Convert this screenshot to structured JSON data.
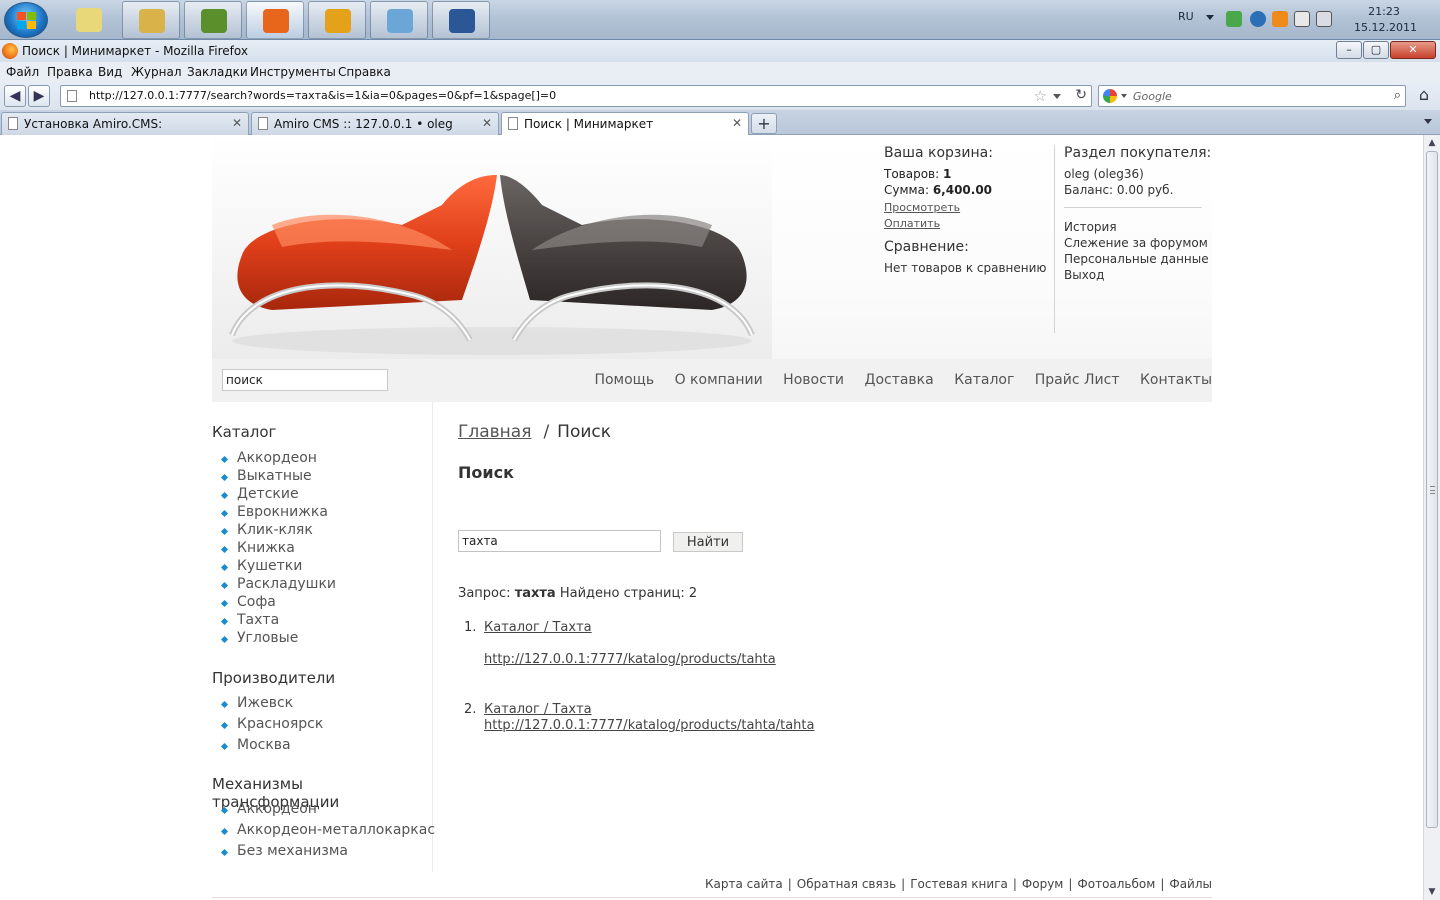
{
  "taskbar": {
    "language": "RU",
    "time": "21:23",
    "date": "15.12.2011",
    "apps": [
      {
        "name": "explorer-icon",
        "color": "#d9b24a"
      },
      {
        "name": "plant-icon",
        "color": "#5a8f2c"
      },
      {
        "name": "firefox-icon",
        "color": "#e8651c"
      },
      {
        "name": "aimp-icon",
        "color": "#e4a21a"
      },
      {
        "name": "notepad-icon",
        "color": "#6aa7d6"
      },
      {
        "name": "word-icon",
        "color": "#2b5797"
      }
    ]
  },
  "window": {
    "title": "Поиск | Минимаркет - Mozilla Firefox"
  },
  "menu": [
    "Файл",
    "Правка",
    "Вид",
    "Журнал",
    "Закладки",
    "Инструменты",
    "Справка"
  ],
  "nav": {
    "url": "http://127.0.0.1:7777/search?words=тахта&is=1&ia=0&pages=0&pf=1&spage[]=0",
    "search_placeholder": "Google"
  },
  "tabs": [
    {
      "label": "Установка Amiro.CMS:"
    },
    {
      "label": "Amiro CMS :: 127.0.0.1 • oleg"
    },
    {
      "label": "Поиск | Минимаркет"
    }
  ],
  "header": {
    "cart": {
      "title": "Ваша корзина:",
      "items_label": "Товаров:",
      "items_value": "1",
      "sum_label": "Сумма:",
      "sum_value": "6,400.00",
      "view_link": "Просмотреть",
      "pay_link": "Оплатить"
    },
    "compare": {
      "title": "Сравнение:",
      "empty": "Нет товаров к сравнению"
    },
    "user": {
      "title": "Раздел покупателя:",
      "name": "oleg (oleg36)",
      "balance": "Баланс: 0.00 руб.",
      "links": [
        "История",
        "Слежение за форумом",
        "Персональные данные",
        "Выход"
      ]
    },
    "search_value": "поиск",
    "top_nav": [
      "Помощь",
      "О компании",
      "Новости",
      "Доставка",
      "Каталог",
      "Прайс Лист",
      "Контакты"
    ]
  },
  "sidebar": {
    "catalog_title": "Каталог",
    "catalog": [
      "Аккордеон",
      "Выкатные",
      "Детские",
      "Еврокнижка",
      "Клик-кляк",
      "Книжка",
      "Кушетки",
      "Раскладушки",
      "Софа",
      "Тахта",
      "Угловые"
    ],
    "makers_title": "Производители",
    "makers": [
      "Ижевск",
      "Красноярск",
      "Москва"
    ],
    "mech_title": "Механизмы трансформации",
    "mech": [
      "Аккордеон",
      "Аккордеон-металлокаркас",
      "Без механизма"
    ]
  },
  "main": {
    "breadcrumb_home": "Главная",
    "breadcrumb_sep": "/",
    "breadcrumb_current": "Поиск",
    "title": "Поиск",
    "query_value": "тахта",
    "submit_label": "Найти",
    "summary_query_label": "Запрос:",
    "summary_query": "тахта",
    "summary_found": "Найдено страниц:",
    "summary_count": "2",
    "results": [
      {
        "num": "1.",
        "title": "Каталог / Тахта",
        "url": "http://127.0.0.1:7777/katalog/products/tahta"
      },
      {
        "num": "2.",
        "title": "Каталог / Тахта",
        "url": "http://127.0.0.1:7777/katalog/products/tahta/tahta"
      }
    ]
  },
  "footer": [
    "Карта сайта",
    "Обратная связь",
    "Гостевая книга",
    "Форум",
    "Фотоальбом",
    "Файлы"
  ]
}
